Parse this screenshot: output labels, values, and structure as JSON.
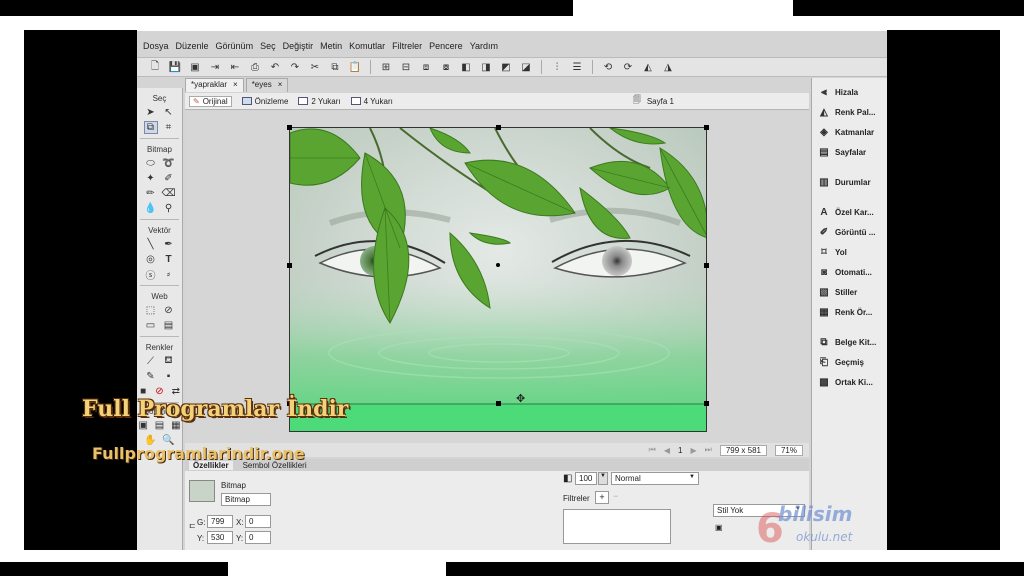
{
  "menu": [
    "Dosya",
    "Düzenle",
    "Görünüm",
    "Seç",
    "Değiştir",
    "Metin",
    "Komutlar",
    "Filtreler",
    "Pencere",
    "Yardım"
  ],
  "doc_tabs": [
    {
      "label": "*yapraklar",
      "close": "×"
    },
    {
      "label": "*eyes",
      "close": "×"
    }
  ],
  "view_modes": [
    "Orijinal",
    "Önizleme",
    "2 Yukarı",
    "4 Yukarı"
  ],
  "page_label": "Sayfa 1",
  "tools": {
    "sec": "Seç",
    "bitmap": "Bitmap",
    "vektor": "Vektör",
    "web": "Web",
    "renkler": "Renkler",
    "gorunum": "Görünüm"
  },
  "status": {
    "page_num": "1",
    "size": "799 x 581",
    "zoom": "71%"
  },
  "prop_tabs": [
    "Özellikler",
    "Sembol Özellikleri"
  ],
  "properties": {
    "type": "Bitmap",
    "name": "Bitmap",
    "w_label": "G:",
    "w": "799",
    "h_label": "Y:",
    "h": "530",
    "x_label": "X:",
    "x": "0",
    "y_label": "Y:",
    "y": "0",
    "opacity": "100",
    "blend": "Normal",
    "filters_label": "Filtreler",
    "style": "Stil Yok"
  },
  "right_panels": [
    {
      "icon": "align-icon",
      "label": "Hizala"
    },
    {
      "icon": "palette-icon",
      "label": "Renk Pal..."
    },
    {
      "icon": "layers-icon",
      "label": "Katmanlar"
    },
    {
      "icon": "pages-icon",
      "label": "Sayfalar"
    },
    {
      "icon": "states-icon",
      "label": "Durumlar"
    },
    {
      "icon": "font-icon",
      "label": "Özel Kar..."
    },
    {
      "icon": "view-icon",
      "label": "Görüntü ..."
    },
    {
      "icon": "path-icon",
      "label": "Yol"
    },
    {
      "icon": "auto-icon",
      "label": "Otomati..."
    },
    {
      "icon": "styles-icon",
      "label": "Stiller"
    },
    {
      "icon": "swatches-icon",
      "label": "Renk Ör..."
    },
    {
      "icon": "library-icon",
      "label": "Belge Kit..."
    },
    {
      "icon": "history-icon",
      "label": "Geçmiş"
    },
    {
      "icon": "common-library-icon",
      "label": "Ortak Ki..."
    }
  ],
  "watermark": {
    "title": "Full Programlar İndir",
    "url": "Fullprogramlarindir.one"
  },
  "logo": {
    "top": "bilisim",
    "bottom": "okulu.net"
  },
  "colors": {
    "frame": "#000000",
    "app_bg": "#d4d4d4",
    "leaf_green": "#4e9a2a"
  }
}
